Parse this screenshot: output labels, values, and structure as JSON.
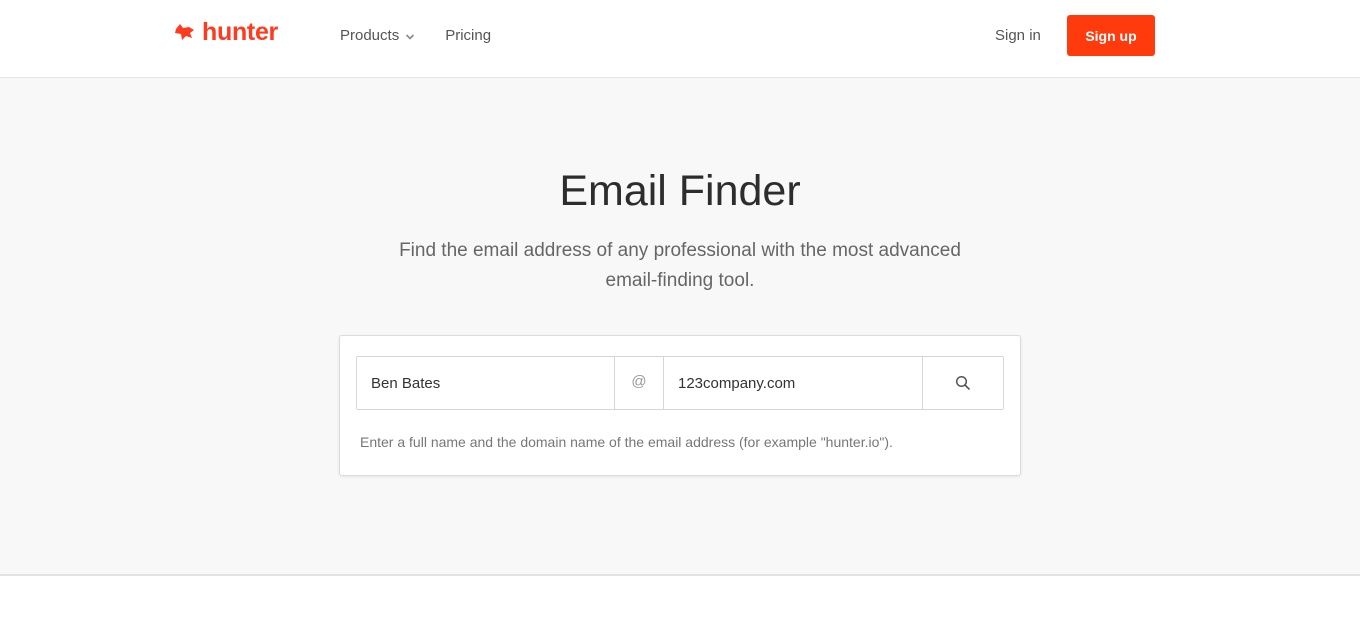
{
  "header": {
    "logo_text": "hunter",
    "brand_color": "#ff3b1f",
    "nav": [
      {
        "label": "Products",
        "icon": "chevron-down-icon"
      },
      {
        "label": "Pricing"
      }
    ],
    "signin_label": "Sign in",
    "signup_label": "Sign up"
  },
  "hero": {
    "title": "Email Finder",
    "subtitle": "Find the email address of any professional with the most advanced email-finding tool."
  },
  "finder": {
    "name_value": "Ben Bates",
    "at_symbol": "@",
    "domain_value": "123company.com",
    "search_icon": "search-icon",
    "hint": "Enter a full name and the domain name of the email address (for example \"hunter.io\")."
  }
}
